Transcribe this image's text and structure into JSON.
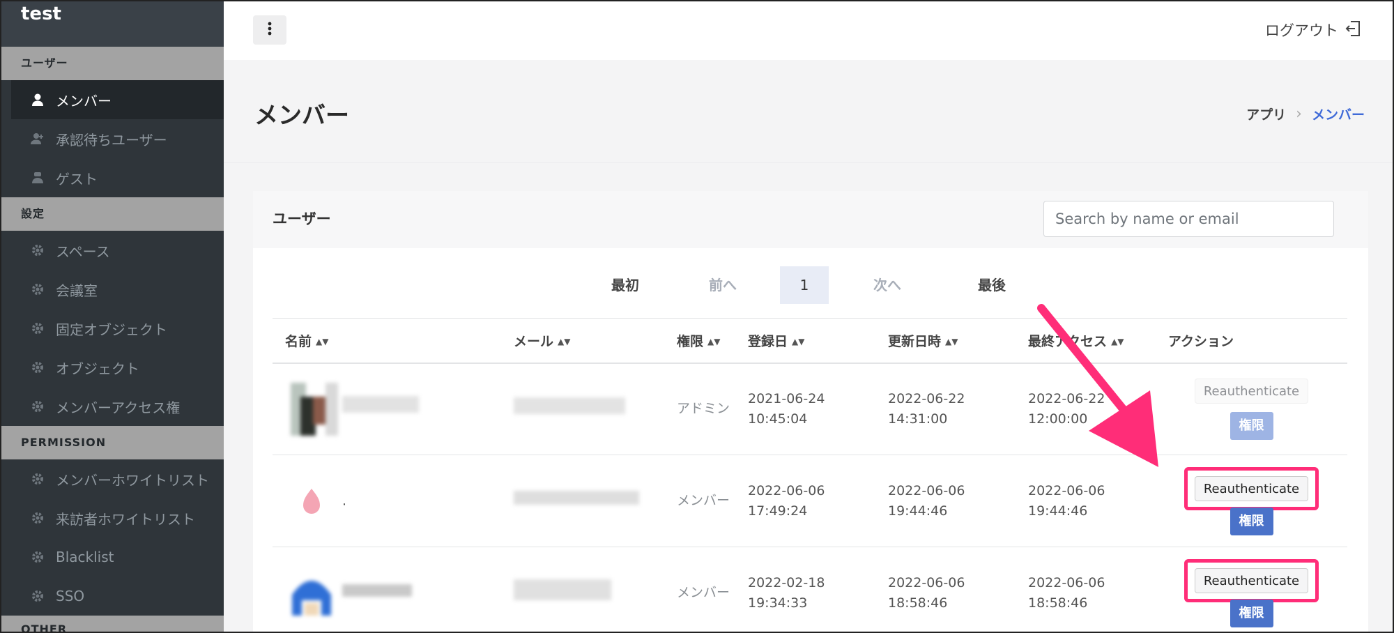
{
  "app": {
    "title": "test"
  },
  "sidebar": {
    "sections": [
      {
        "label": "ユーザー",
        "items": [
          {
            "label": "メンバー",
            "icon": "user-icon",
            "active": true
          },
          {
            "label": "承認待ちユーザー",
            "icon": "user-plus-icon"
          },
          {
            "label": "ゲスト",
            "icon": "guest-icon"
          }
        ]
      },
      {
        "label": "設定",
        "items": [
          {
            "label": "スペース",
            "icon": "gear-icon"
          },
          {
            "label": "会議室",
            "icon": "gear-icon"
          },
          {
            "label": "固定オブジェクト",
            "icon": "gear-icon"
          },
          {
            "label": "オブジェクト",
            "icon": "gear-icon"
          },
          {
            "label": "メンバーアクセス権",
            "icon": "gear-icon"
          }
        ]
      },
      {
        "label": "PERMISSION",
        "items": [
          {
            "label": "メンバーホワイトリスト",
            "icon": "gear-icon"
          },
          {
            "label": "来訪者ホワイトリスト",
            "icon": "gear-icon"
          },
          {
            "label": "Blacklist",
            "icon": "gear-icon"
          },
          {
            "label": "SSO",
            "icon": "gear-icon"
          }
        ]
      },
      {
        "label": "OTHER",
        "items": []
      }
    ]
  },
  "topbar": {
    "logout_label": "ログアウト"
  },
  "page": {
    "title": "メンバー",
    "breadcrumb_home": "アプリ",
    "breadcrumb_current": "メンバー"
  },
  "card": {
    "title": "ユーザー",
    "search_placeholder": "Search by name or email"
  },
  "pagination": {
    "first": "最初",
    "prev": "前へ",
    "current": "1",
    "next": "次へ",
    "last": "最後"
  },
  "table": {
    "headers": [
      "名前",
      "メール",
      "権限",
      "登録日",
      "更新日時",
      "最終アクセス",
      "アクション"
    ],
    "rows": [
      {
        "role": "アドミン",
        "registered": [
          "2021-06-24",
          "10:45:04"
        ],
        "updated": [
          "2022-06-22",
          "14:31:00"
        ],
        "last_access": [
          "2022-06-22",
          "12:00:00"
        ],
        "reauth": "Reauthenticate",
        "perm": "権限"
      },
      {
        "name_suffix": ".",
        "role": "メンバー",
        "registered": [
          "2022-06-06",
          "17:49:24"
        ],
        "updated": [
          "2022-06-06",
          "19:44:46"
        ],
        "last_access": [
          "2022-06-06",
          "19:44:46"
        ],
        "reauth": "Reauthenticate",
        "perm": "権限"
      },
      {
        "role": "メンバー",
        "registered": [
          "2022-02-18",
          "19:34:33"
        ],
        "updated": [
          "2022-06-06",
          "18:58:46"
        ],
        "last_access": [
          "2022-06-06",
          "18:58:46"
        ],
        "reauth": "Reauthenticate",
        "perm": "権限"
      }
    ]
  },
  "colors": {
    "accent": "#3f6ad8",
    "highlight": "#ff2d78",
    "sidebar_bg": "#2f353a"
  }
}
